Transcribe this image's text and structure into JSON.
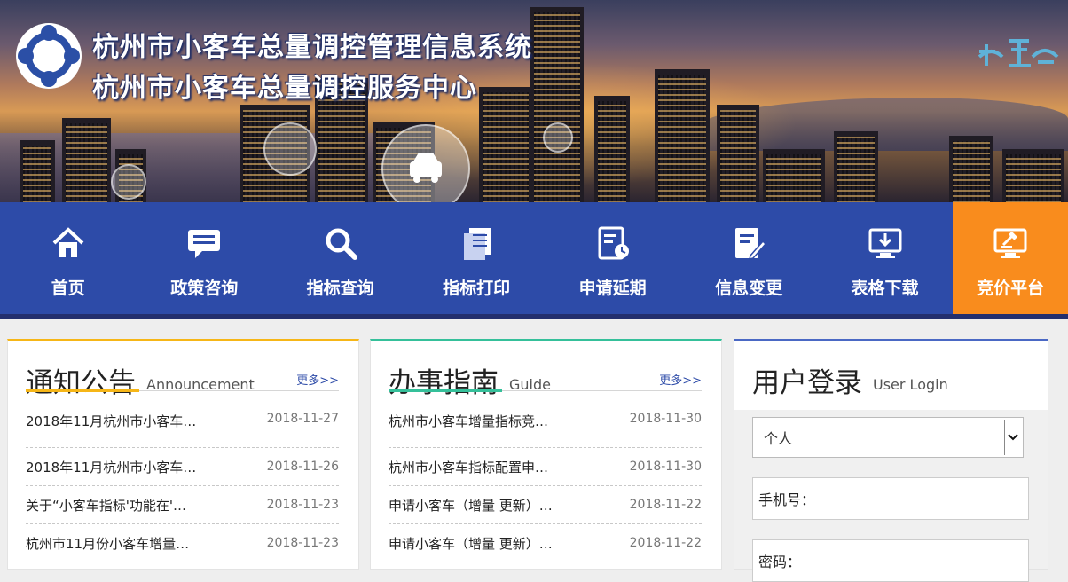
{
  "header": {
    "title_line1": "杭州市小客车总量调控管理信息系统",
    "title_line2": "杭州市小客车总量调控服务中心"
  },
  "nav": {
    "items": [
      {
        "label": "首页",
        "icon": "home-icon"
      },
      {
        "label": "政策咨询",
        "icon": "chat-icon"
      },
      {
        "label": "指标查询",
        "icon": "search-icon"
      },
      {
        "label": "指标打印",
        "icon": "print-document-icon"
      },
      {
        "label": "申请延期",
        "icon": "document-clock-icon"
      },
      {
        "label": "信息变更",
        "icon": "edit-document-icon"
      },
      {
        "label": "表格下载",
        "icon": "download-monitor-icon"
      },
      {
        "label": "竞价平台",
        "icon": "bid-monitor-icon"
      }
    ],
    "active_color": "#f98c1d",
    "bar_color": "#2d4ba8"
  },
  "announcement": {
    "title_cn": "通知公告",
    "title_en": "Announcement",
    "more": "更多>>",
    "accent": "#f6b617",
    "items": [
      {
        "text": "2018年11月杭州市小客车…",
        "date": "2018-11-27"
      },
      {
        "text": "2018年11月杭州市小客车…",
        "date": "2018-11-26"
      },
      {
        "text": "关于“小客车指标'功能在'…",
        "date": "2018-11-23"
      },
      {
        "text": "杭州市11月份小客车增量…",
        "date": "2018-11-23"
      }
    ]
  },
  "guide": {
    "title_cn": "办事指南",
    "title_en": "Guide",
    "more": "更多>>",
    "accent": "#35c09a",
    "items": [
      {
        "text": "杭州市小客车增量指标竞…",
        "date": "2018-11-30"
      },
      {
        "text": "杭州市小客车指标配置申…",
        "date": "2018-11-30"
      },
      {
        "text": "申请小客车（增量 更新）…",
        "date": "2018-11-22"
      },
      {
        "text": "申请小客车（增量 更新）…",
        "date": "2018-11-22"
      }
    ]
  },
  "login": {
    "title_cn": "用户登录",
    "title_en": "User Login",
    "user_type": "个人",
    "phone_label": "手机号：",
    "password_label": "密码："
  }
}
